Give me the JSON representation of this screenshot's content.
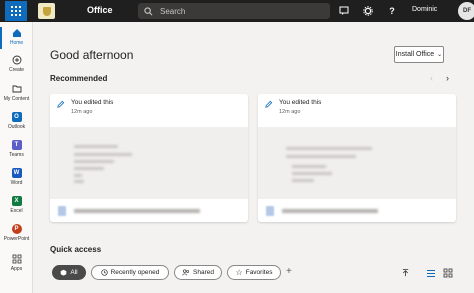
{
  "topbar": {
    "app_name": "Office",
    "search_placeholder": "Search",
    "user_name": "Dominic",
    "avatar_initials": "DF",
    "icons": [
      "app-launcher-icon",
      "org-logo",
      "search-icon",
      "feedback-icon",
      "settings-icon",
      "help-icon"
    ]
  },
  "rail": {
    "items": [
      {
        "label": "Home",
        "icon": "home-icon",
        "active": true
      },
      {
        "label": "Create",
        "icon": "plus-circle-icon"
      },
      {
        "label": "My Content",
        "icon": "folder-icon"
      },
      {
        "label": "Outlook",
        "icon": "outlook-icon",
        "color": "#0f6cbd"
      },
      {
        "label": "Teams",
        "icon": "teams-icon",
        "color": "#5b5fc7"
      },
      {
        "label": "Word",
        "icon": "word-icon",
        "color": "#185abd"
      },
      {
        "label": "Excel",
        "icon": "excel-icon",
        "color": "#107c41"
      },
      {
        "label": "PowerPoint",
        "icon": "powerpoint-icon",
        "color": "#c43e1c"
      },
      {
        "label": "Apps",
        "icon": "apps-icon"
      }
    ]
  },
  "main": {
    "greeting": "Good afternoon",
    "install_label": "Install Office",
    "recommended_title": "Recommended",
    "cards": [
      {
        "title": "You edited this",
        "time": "12m ago"
      },
      {
        "title": "You edited this",
        "time": "12m ago"
      }
    ],
    "quick_access_title": "Quick access",
    "filters": [
      {
        "label": "All",
        "selected": true
      },
      {
        "label": "Recently opened"
      },
      {
        "label": "Shared"
      },
      {
        "label": "Favorites"
      }
    ]
  },
  "colors": {
    "accent": "#0f6cbd",
    "topbar": "#1f1f1f",
    "background": "#f3f2f1"
  }
}
